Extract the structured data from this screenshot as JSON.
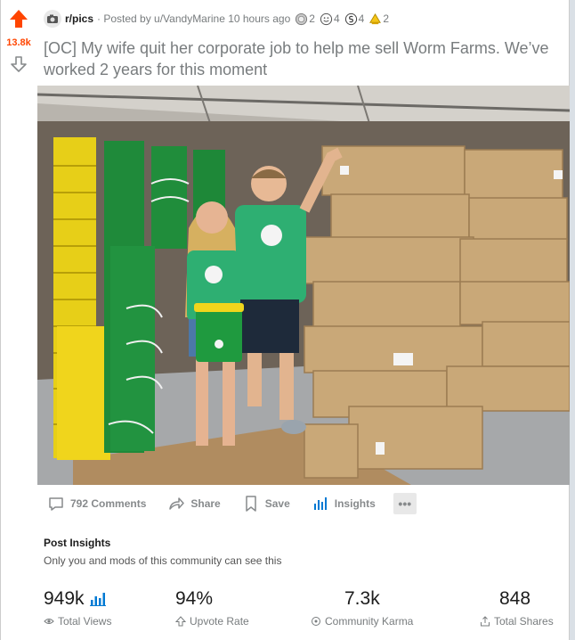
{
  "post": {
    "score": "13.8k",
    "subreddit": "r/pics",
    "posted_by": "· Posted by u/VandyMarine 10 hours ago",
    "awards": [
      {
        "icon": "silver-award-icon",
        "count": "2"
      },
      {
        "icon": "wholesome-award-icon",
        "count": "4"
      },
      {
        "icon": "helpful-award-icon",
        "count": "4"
      },
      {
        "icon": "gold-award-icon",
        "count": "2"
      }
    ],
    "title": "[OC] My wife quit her corporate job to help me sell Worm Farms. We’ve worked 2 years for this moment"
  },
  "actions": {
    "comments": "792 Comments",
    "share": "Share",
    "save": "Save",
    "insights": "Insights",
    "more": "•••"
  },
  "insights": {
    "title": "Post Insights",
    "subtitle": "Only you and mods of this community can see this",
    "stats": [
      {
        "value": "949k",
        "label": "Total Views"
      },
      {
        "value": "94%",
        "label": "Upvote Rate"
      },
      {
        "value": "7.3k",
        "label": "Community Karma"
      },
      {
        "value": "848",
        "label": "Total Shares"
      }
    ]
  },
  "colors": {
    "upvote": "#ff4500",
    "meta_text": "#787c7e",
    "insights_blue": "#0079d3"
  }
}
